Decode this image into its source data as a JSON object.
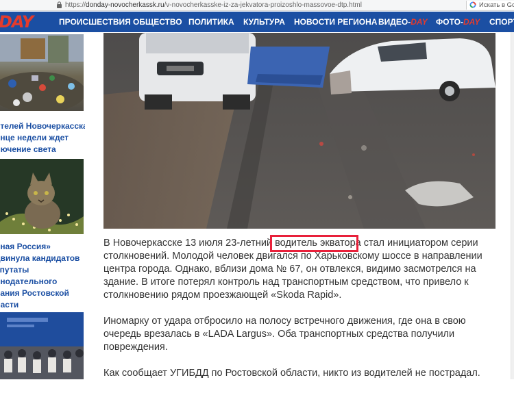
{
  "browser": {
    "url_host": "donday-novocherkassk.ru",
    "url_path": "/v-novocherkasske-iz-za-jekvatora-proizoshlo-massovoe-dtp.html",
    "search_placeholder": "Искать в Go"
  },
  "site": {
    "logo_text": "DAY",
    "brand_color": "#1b4fa3",
    "accent_color": "#e53b2c"
  },
  "nav": {
    "items": [
      {
        "label": "ПРОИСШЕСТВИЯ"
      },
      {
        "label": "ОБЩЕСТВО"
      },
      {
        "label": "ПОЛИТИКА"
      },
      {
        "label": "КУЛЬТУРА"
      },
      {
        "label": "НОВОСТИ РЕГИОНА"
      },
      {
        "label": "ВИДЕО-",
        "highlight": "DAY"
      },
      {
        "label": "ФОТО-",
        "highlight": "DAY"
      },
      {
        "label": "СПОРТ"
      }
    ]
  },
  "sidebar": {
    "news1": {
      "lines": [
        "ителей Новочеркасска",
        "онце недели ждет",
        "лючение света"
      ]
    },
    "news2": {
      "lines": [
        "иная Россия»",
        "двинула кандидатов",
        "епутаты",
        "онодательного",
        "рания Ростовской",
        "ласти"
      ]
    }
  },
  "article": {
    "p1_before": "В Новочеркасске 13 июля 23-летний ",
    "p1_highlight": "водитель экватора",
    "p1_after": " стал инициатором серии столкновений. Молодой человек двигался по Харьковскому шоссе в направлении центра города. Однако, вблизи дома № 67, он отвлекся, видимо засмотрелся на здание. В итоге потерял контроль над транспортным средством, что привело к столкновению рядом проезжающей «Skoda Rapid».",
    "p2": "Иномарку от удара отбросило на полосу встречного движения, где она в свою очередь врезалась в «LADA Largus». Оба транспортных средства получили повреждения.",
    "p3": "Как сообщает УГИБДД по Ростовской области, никто из водителей не пострадал."
  },
  "highlight_box_color": "#e8203a"
}
